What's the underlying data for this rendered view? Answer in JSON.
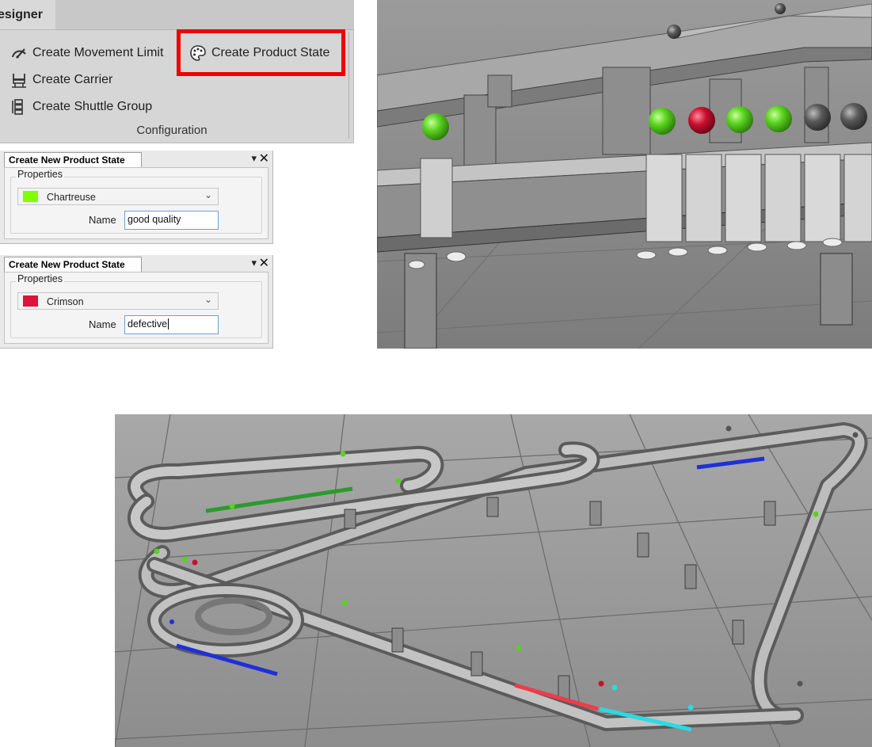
{
  "ribbon": {
    "tab_label": "esigner",
    "buttons": {
      "movement_limit": "Create Movement Limit",
      "product_state": "Create Product State",
      "carrier": "Create Carrier",
      "shuttle_group": "Create Shuttle Group"
    },
    "group_label": "Configuration"
  },
  "dialogs": [
    {
      "title": "Create New Product State",
      "pin_icon": "▾",
      "close_icon": "✕",
      "properties_label": "Properties",
      "color_name": "Chartreuse",
      "color_hex": "#7fff00",
      "name_label": "Name",
      "name_value": "good quality"
    },
    {
      "title": "Create New Product State",
      "pin_icon": "▾",
      "close_icon": "✕",
      "properties_label": "Properties",
      "color_name": "Crimson",
      "color_hex": "#dc143c",
      "name_label": "Name",
      "name_value": "defective"
    }
  ],
  "colors": {
    "highlight": "#ef0000",
    "good_state": "#59d21e",
    "defective_state": "#c8102e",
    "neutral_state": "#555555",
    "blue_zone": "#1f2fd8",
    "green_zone": "#2c9a2c",
    "red_zone": "#ef3b4a",
    "cyan_zone": "#2bd9e3"
  }
}
